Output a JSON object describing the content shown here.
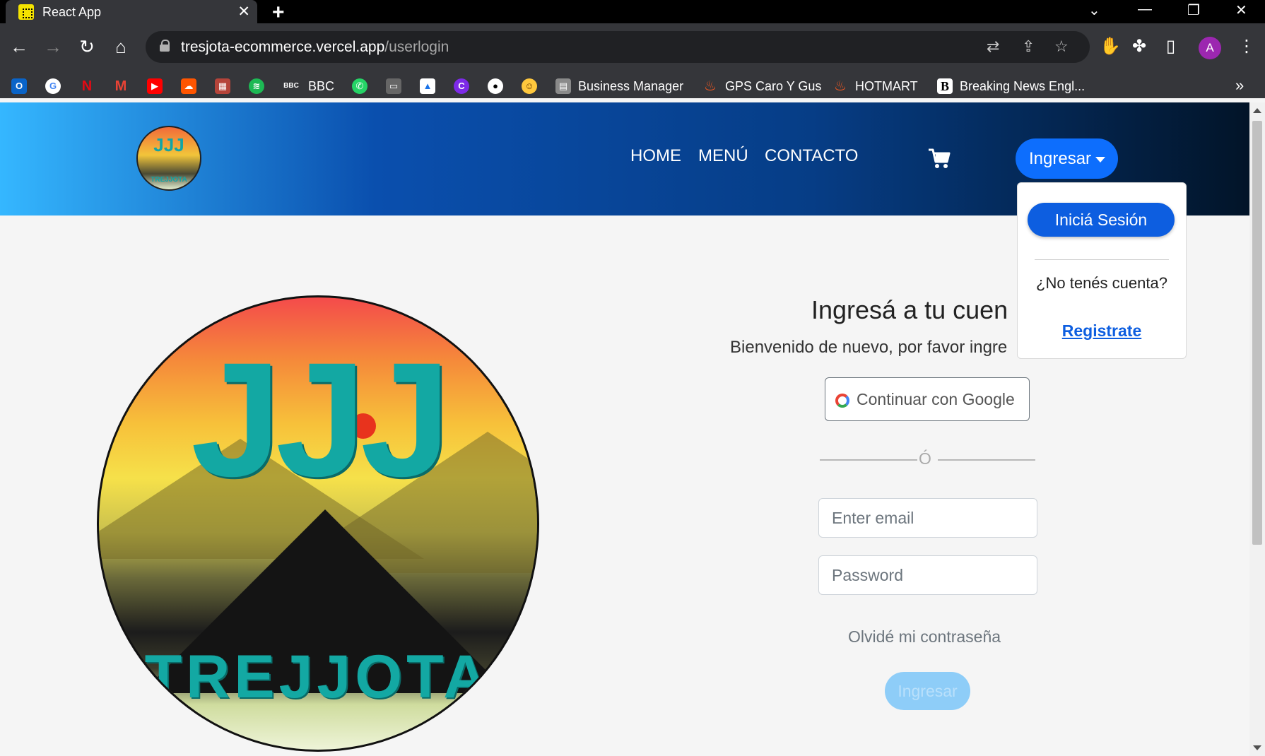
{
  "browser": {
    "tab_title": "React App",
    "tab_close": "✕",
    "new_tab": "+",
    "url_domain": "tresjota-ecommerce.vercel.app",
    "url_path": "/userlogin",
    "avatar_initial": "A",
    "bookmarks": [
      {
        "label": "BBC",
        "icon": "bbc-icon"
      },
      {
        "label": "Business Manager",
        "icon": "business-manager-icon"
      },
      {
        "label": "GPS Caro Y Gus",
        "icon": "fire-icon"
      },
      {
        "label": "HOTMART",
        "icon": "fire-icon"
      },
      {
        "label": "Breaking News Engl...",
        "icon": "b-icon"
      }
    ],
    "bbc_icon_text": "BBC",
    "b_icon_text": "B",
    "more_bookmarks": "»"
  },
  "navbar": {
    "links": [
      "HOME",
      "MENÚ",
      "CONTACTO"
    ],
    "login_button": "Ingresar",
    "logo_letters": "JJJ",
    "logo_text": "TREJJOTA"
  },
  "dropdown": {
    "login_option": "Iniciá Sesión",
    "no_account_text": "¿No tenés cuenta?",
    "register_link": "Registrate"
  },
  "hero": {
    "letters": "JJJ",
    "brand_name": "TREJJOTA"
  },
  "login": {
    "title": "Ingresá a tu cuen",
    "subtitle": "Bienvenido de nuevo, por favor ingre",
    "google_button": "Continuar con Google",
    "separator": "Ó",
    "email_placeholder": "Enter email",
    "password_placeholder": "Password",
    "forgot_password": "Olvidé mi contraseña",
    "submit_button": "Ingresar"
  },
  "colors": {
    "primary": "#0d6efd",
    "teal": "#13a8a3"
  }
}
